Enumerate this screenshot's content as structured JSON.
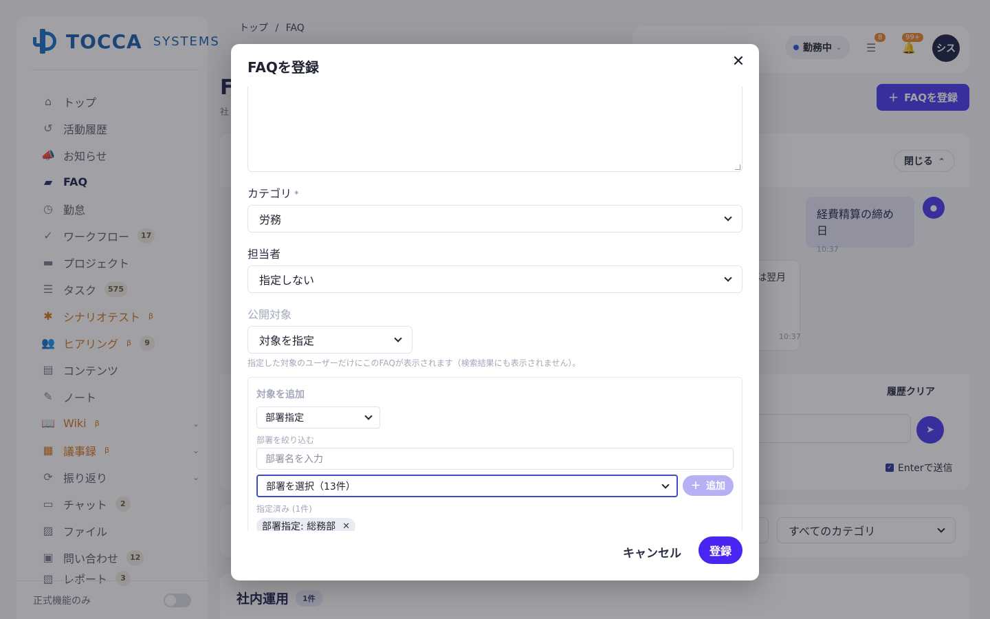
{
  "brand": {
    "name": "TOCCA",
    "sub": "SYSTEMS"
  },
  "sidebar": {
    "items": [
      {
        "label": "トップ",
        "icon": "home-icon",
        "glyph": "⌂"
      },
      {
        "label": "活動履歴",
        "icon": "history-icon",
        "glyph": "↺"
      },
      {
        "label": "お知らせ",
        "icon": "megaphone-icon",
        "glyph": "📣"
      },
      {
        "label": "FAQ",
        "icon": "chat-bubbles-icon",
        "glyph": "▰"
      },
      {
        "label": "勤怠",
        "icon": "clock-icon",
        "glyph": "◷"
      },
      {
        "label": "ワークフロー",
        "icon": "check-circle-icon",
        "glyph": "✓",
        "badge": "17"
      },
      {
        "label": "プロジェクト",
        "icon": "folder-icon",
        "glyph": "▬"
      },
      {
        "label": "タスク",
        "icon": "checklist-icon",
        "glyph": "☰",
        "badge": "575"
      },
      {
        "label": "シナリオテスト",
        "icon": "bug-icon",
        "glyph": "✱",
        "beta": "β"
      },
      {
        "label": "ヒアリング",
        "icon": "users-icon",
        "glyph": "👥",
        "beta": "β",
        "badge": "9"
      },
      {
        "label": "コンテンツ",
        "icon": "document-icon",
        "glyph": "▤"
      },
      {
        "label": "ノート",
        "icon": "note-icon",
        "glyph": "✎"
      },
      {
        "label": "Wiki",
        "icon": "book-icon",
        "glyph": "📖",
        "beta": "β"
      },
      {
        "label": "議事録",
        "icon": "calendar-icon",
        "glyph": "▦",
        "beta": "β"
      },
      {
        "label": "振り返り",
        "icon": "refresh-icon",
        "glyph": "⟳"
      },
      {
        "label": "チャット",
        "icon": "chat-icon",
        "glyph": "▭",
        "badge": "2"
      },
      {
        "label": "ファイル",
        "icon": "image-icon",
        "glyph": "▨"
      },
      {
        "label": "問い合わせ",
        "icon": "id-card-icon",
        "glyph": "▣",
        "badge": "12"
      },
      {
        "label": "レポート",
        "icon": "report-icon",
        "glyph": "▧",
        "badge": "3"
      }
    ],
    "footer_label": "正式機能のみ"
  },
  "breadcrumb": {
    "home": "トップ",
    "sep": "/",
    "current": "FAQ"
  },
  "topbar": {
    "status": "勤務中",
    "task_badge": "8",
    "notif_badge": "99+",
    "avatar": "シス"
  },
  "page": {
    "title": "F",
    "subtitle": "社",
    "register_button": "FAQを登録"
  },
  "chat": {
    "close_label": "閉じる",
    "user_message": "経費精算の締め日",
    "user_time": "10:37",
    "bot_fragment": "は翌月",
    "bot_time": "10:37",
    "history_clear": "履歴クリア",
    "enter_send": "Enterで送信"
  },
  "filters": {
    "category": "すべてのカテゴリ"
  },
  "section": {
    "title": "社内運用",
    "count": "1件"
  },
  "modal": {
    "title": "FAQを登録",
    "category_label": "カテゴリ",
    "required_mark": "*",
    "category_value": "労務",
    "assignee_label": "担当者",
    "assignee_value": "指定しない",
    "audience_label": "公開対象",
    "audience_value": "対象を指定",
    "audience_help": "指定した対象のユーザーだけにこのFAQが表示されます（検索結果にも表示されません）。",
    "add_target_title": "対象を追加",
    "target_type_value": "部署指定",
    "dept_filter_label": "部署を絞り込む",
    "dept_filter_placeholder": "部署名を入力",
    "dept_select_value": "部署を選択（13件）",
    "add_button": "追加",
    "assigned_label": "指定済み (1件)",
    "assigned_chip": "部署指定: 総務部",
    "cancel_button": "キャンセル",
    "submit_button": "登録"
  },
  "colors": {
    "primary": "#4a24f0",
    "brand": "#1b5fae",
    "accent_orange": "#d5761a"
  }
}
